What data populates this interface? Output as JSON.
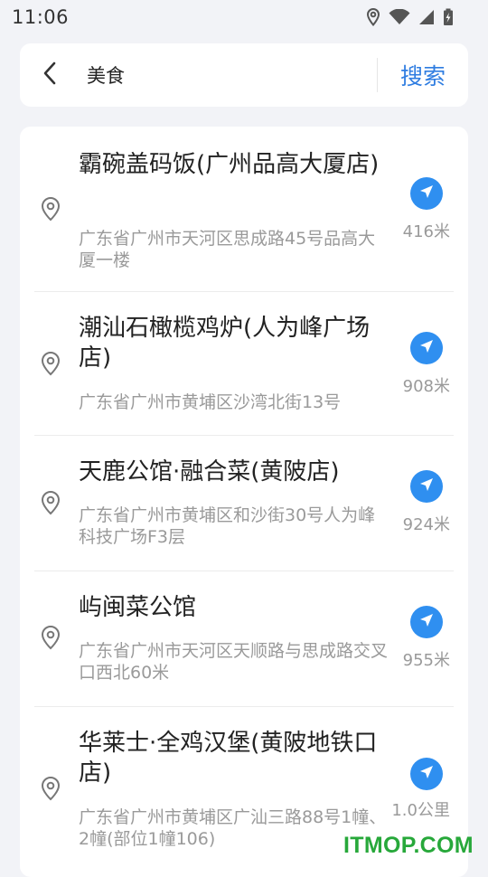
{
  "status_bar": {
    "time": "11:06"
  },
  "search": {
    "query": "美食",
    "button_label": "搜索"
  },
  "results": [
    {
      "name": "霸碗盖码饭(广州品高大厦店)",
      "address": "广东省广州市天河区思成路45号品高大厦一楼",
      "distance": "416米"
    },
    {
      "name": "潮汕石橄榄鸡炉(人为峰广场店)",
      "address": "广东省广州市黄埔区沙湾北街13号",
      "distance": "908米"
    },
    {
      "name": "天鹿公馆·融合菜(黄陂店)",
      "address": "广东省广州市黄埔区和沙街30号人为峰科技广场F3层",
      "distance": "924米"
    },
    {
      "name": "屿闽菜公馆",
      "address": "广东省广州市天河区天顺路与思成路交叉口西北60米",
      "distance": "955米"
    },
    {
      "name": "华莱士·全鸡汉堡(黄陂地铁口店)",
      "address": "广东省广州市黄埔区广汕三路88号1幢、2幢(部位1幢106)",
      "distance": "1.0公里"
    }
  ],
  "icons": {
    "back": "chevron-left-icon",
    "pin": "location-pin-icon",
    "navigate": "navigation-arrow-icon"
  },
  "colors": {
    "accent": "#2f7de1",
    "nav_button": "#2f8ff0",
    "watermark": "#27a83a"
  },
  "watermark": "ITMOP.COM"
}
